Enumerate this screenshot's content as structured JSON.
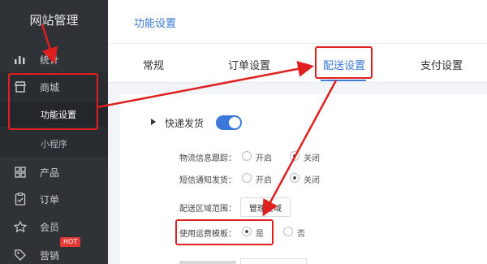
{
  "sidebar": {
    "brand": "网站管理",
    "items": [
      {
        "label": "统计",
        "icon": "bar-chart-icon"
      },
      {
        "label": "商城",
        "icon": "store-icon"
      },
      {
        "label": "产品",
        "icon": "grid-icon"
      },
      {
        "label": "订单",
        "icon": "order-icon"
      },
      {
        "label": "会员",
        "icon": "member-icon"
      },
      {
        "label": "营销",
        "icon": "tag-icon"
      }
    ],
    "subitems": [
      {
        "label": "功能设置",
        "active": true
      },
      {
        "label": "小程序",
        "active": false
      }
    ],
    "hot_badge": "HOT"
  },
  "header": {
    "title": "功能设置"
  },
  "tabs": [
    {
      "label": "常规"
    },
    {
      "label": "订单设置"
    },
    {
      "label": "配送设置",
      "active": true
    },
    {
      "label": "支付设置"
    }
  ],
  "section": {
    "title": "快递发货",
    "enabled": true,
    "rows": {
      "tracking": {
        "label": "物流信息跟踪：",
        "options": [
          "开启",
          "关闭"
        ],
        "selected": "关闭"
      },
      "sms": {
        "label": "短信通知发货：",
        "options": [
          "开启",
          "关闭"
        ],
        "selected": "关闭"
      },
      "range": {
        "label": "配送区域范围：",
        "button": "管理区域"
      },
      "template": {
        "label": "使用运费模板：",
        "options": [
          "是",
          "否"
        ],
        "selected": "是"
      }
    }
  },
  "colors": {
    "accent": "#3a79d9",
    "annotation": "#e01f1f",
    "sidebar_bg": "#2f3338"
  }
}
